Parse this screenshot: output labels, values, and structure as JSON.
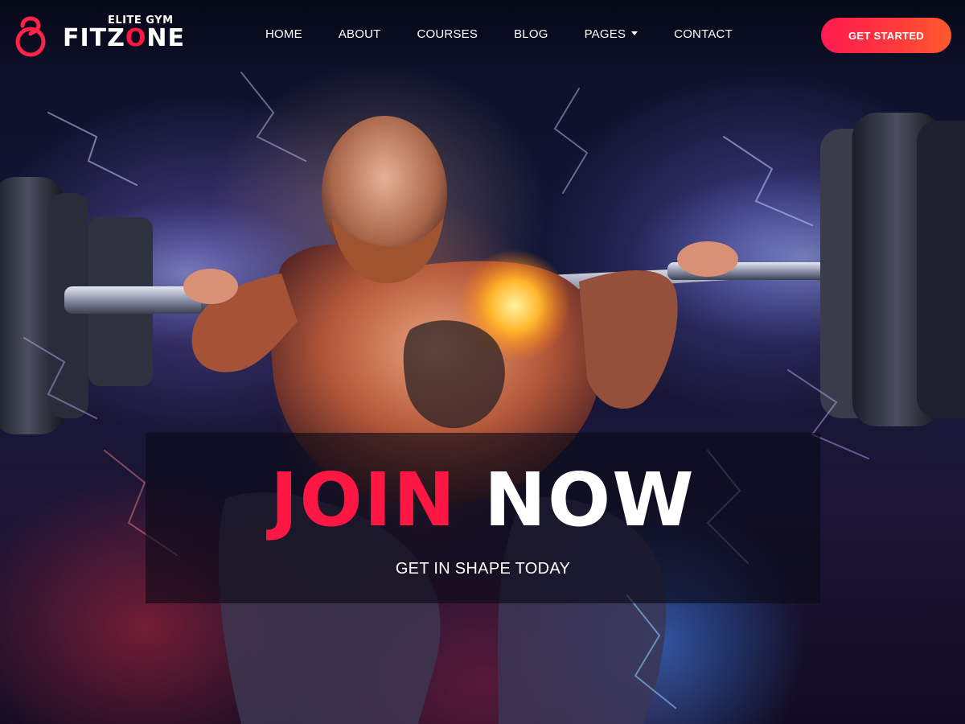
{
  "brand": {
    "tagline": "ELITE GYM",
    "name_part_1": "FITZ",
    "name_accent": "O",
    "name_part_2": "NE",
    "accent_color": "#ff1744"
  },
  "nav": {
    "items": [
      {
        "label": "HOME"
      },
      {
        "label": "ABOUT"
      },
      {
        "label": "COURSES"
      },
      {
        "label": "BLOG"
      },
      {
        "label": "PAGES",
        "has_dropdown": true
      },
      {
        "label": "CONTACT"
      }
    ]
  },
  "cta": {
    "label": "GET STARTED",
    "gradient": [
      "#ff1a4f",
      "#ff5a2e"
    ]
  },
  "hero": {
    "heading_word_1": "JOIN",
    "heading_word_2": "NOW",
    "subheading": "GET IN SHAPE TODAY",
    "image_subject": "bodybuilder-squatting-barbell"
  },
  "icons": {
    "logo": "kettlebell-logo-icon",
    "dropdown": "caret-down-icon"
  }
}
